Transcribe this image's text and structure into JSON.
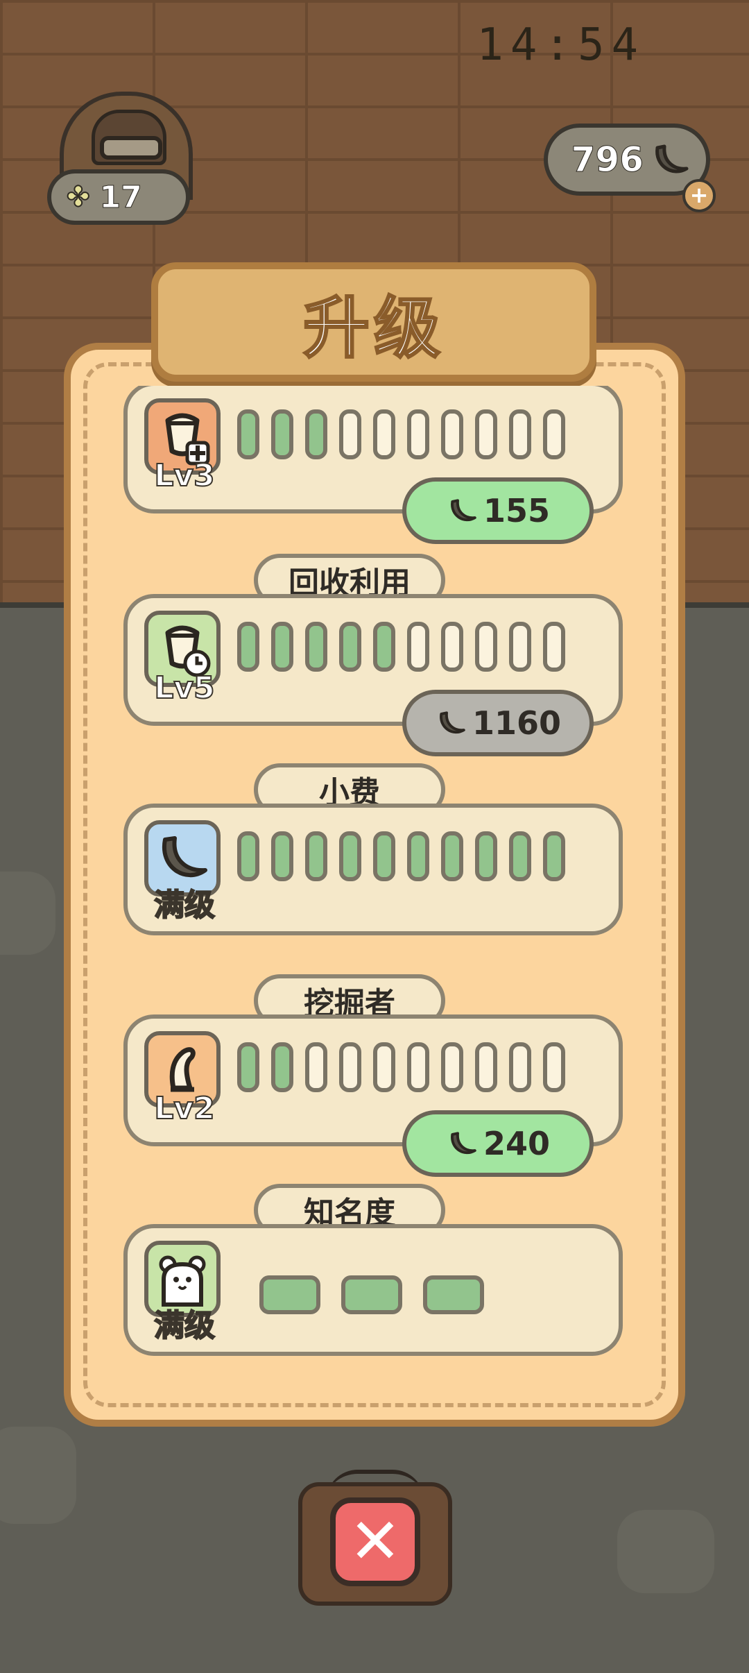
{
  "status_bar": {
    "time": "14:54"
  },
  "hud": {
    "clover_count": "17",
    "banana_count": "796",
    "plus_label": "+"
  },
  "panel": {
    "title": "升级",
    "close_label": "✕"
  },
  "upgrades": [
    {
      "label": "",
      "level_text": "Lv3",
      "icon": "bucket-plus-icon",
      "icon_bg": "#f0a878",
      "filled": 3,
      "total": 10,
      "cost": "155",
      "cost_state": "affordable"
    },
    {
      "label": "回收利用",
      "level_text": "Lv5",
      "icon": "bucket-clock-icon",
      "icon_bg": "#c8e4a8",
      "filled": 5,
      "total": 10,
      "cost": "1160",
      "cost_state": "unaffordable"
    },
    {
      "label": "小费",
      "level_text": "满级",
      "icon": "banana-icon",
      "icon_bg": "#b8d8f0",
      "filled": 10,
      "total": 10,
      "cost": "",
      "cost_state": "maxed"
    },
    {
      "label": "挖掘者",
      "level_text": "Lv2",
      "icon": "claw-icon",
      "icon_bg": "#f6c08a",
      "filled": 2,
      "total": 10,
      "cost": "240",
      "cost_state": "affordable"
    },
    {
      "label": "知名度",
      "level_text": "满级",
      "icon": "bear-icon",
      "icon_bg": "#c8e4a8",
      "filled": 3,
      "total": 3,
      "cost": "",
      "cost_state": "maxed"
    }
  ],
  "colors": {
    "panel_bg": "#fcd59e",
    "bar_filled": "#92c48d",
    "cost_affordable": "#a2e5a0",
    "cost_unaffordable": "#b6b4ad",
    "close_red": "#ee6a6a"
  }
}
